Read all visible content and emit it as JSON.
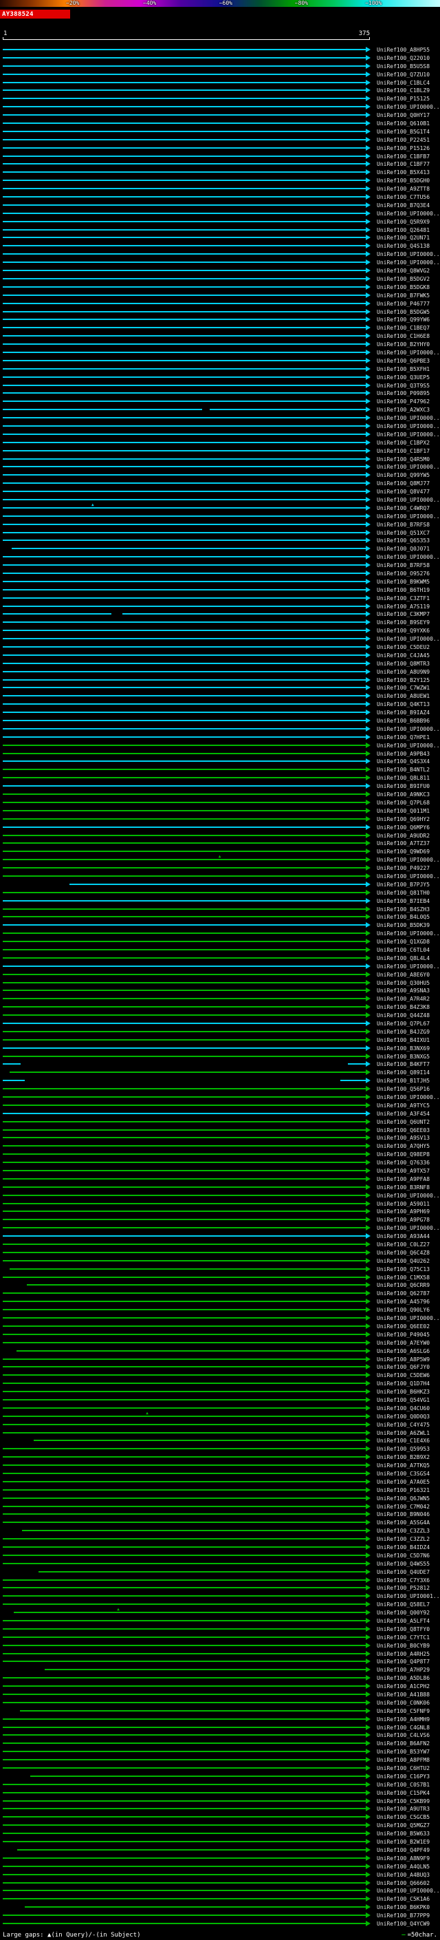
{
  "header": {
    "query_id": "AY388524",
    "scale_ticks": [
      {
        "label": "~20%",
        "pos": 15
      },
      {
        "label": "~40%",
        "pos": 32.5
      },
      {
        "label": "~60%",
        "pos": 49.8
      },
      {
        "label": "~80%",
        "pos": 67
      },
      {
        "label": "~100%",
        "pos": 83
      }
    ],
    "scale_gradient": [
      [
        0,
        "#2a0a00"
      ],
      [
        7,
        "#8a3300"
      ],
      [
        15,
        "#ff8000"
      ],
      [
        24,
        "#cc2090"
      ],
      [
        32,
        "#d000d0"
      ],
      [
        41,
        "#5000a0"
      ],
      [
        50,
        "#101090"
      ],
      [
        59,
        "#005030"
      ],
      [
        67,
        "#00a000"
      ],
      [
        76,
        "#00c860"
      ],
      [
        84,
        "#00e8e8"
      ],
      [
        100,
        "#c8ffff"
      ]
    ],
    "ruler": {
      "start": "1",
      "end": "375"
    }
  },
  "colors": {
    "cyan": "#00d0f0",
    "green": "#00b800",
    "query_bar": "#e00000",
    "label_text": "#e0e0e0",
    "ruler": "#ffffff",
    "background": "#000000"
  },
  "glyphs": {
    "gap_triangle": "▲"
  },
  "footer": {
    "left": "Large gaps: ▲(in Query)/-(in Subject)",
    "scale_dash": "—",
    "scale_text": "=50char."
  },
  "chart_data": {
    "type": "bar",
    "orientation": "horizontal",
    "title": "AY388524",
    "x_range": [
      1,
      375
    ],
    "legend_position": "top",
    "legend_meaning": "percent identity color scale (~20% to ~100%)",
    "rows": [
      {
        "l": "UniRef100_A8HP55",
        "c": "cyan"
      },
      {
        "l": "UniRef100_Q22010",
        "c": "cyan"
      },
      {
        "l": "UniRef100_B5U5S8",
        "c": "cyan"
      },
      {
        "l": "UniRef100_Q7ZU10",
        "c": "cyan"
      },
      {
        "l": "UniRef100_C1BLC4",
        "c": "cyan"
      },
      {
        "l": "UniRef100_C1BLZ9",
        "c": "cyan"
      },
      {
        "l": "UniRef100_P15125",
        "c": "cyan"
      },
      {
        "l": "UniRef100_UPI0000...",
        "c": "cyan"
      },
      {
        "l": "UniRef100_Q0HY17",
        "c": "cyan"
      },
      {
        "l": "UniRef100_Q610B1",
        "c": "cyan"
      },
      {
        "l": "UniRef100_B5G1T4",
        "c": "cyan"
      },
      {
        "l": "UniRef100_P22451",
        "c": "cyan"
      },
      {
        "l": "UniRef100_P15126",
        "c": "cyan"
      },
      {
        "l": "UniRef100_C1BFB7",
        "c": "cyan"
      },
      {
        "l": "UniRef100_C1BF77",
        "c": "cyan"
      },
      {
        "l": "UniRef100_B5X413",
        "c": "cyan"
      },
      {
        "l": "UniRef100_B5DGH0",
        "c": "cyan"
      },
      {
        "l": "UniRef100_A9ZTT8",
        "c": "cyan"
      },
      {
        "l": "UniRef100_C7TU56",
        "c": "cyan"
      },
      {
        "l": "UniRef100_B7Q3E4",
        "c": "cyan"
      },
      {
        "l": "UniRef100_UPI0000...",
        "c": "cyan"
      },
      {
        "l": "UniRef100_Q5R9X9",
        "c": "cyan"
      },
      {
        "l": "UniRef100_Q26481",
        "c": "cyan"
      },
      {
        "l": "UniRef100_Q2UN71",
        "c": "cyan"
      },
      {
        "l": "UniRef100_Q4S138",
        "c": "cyan"
      },
      {
        "l": "UniRef100_UPI0000...",
        "c": "cyan"
      },
      {
        "l": "UniRef100_UPI0000...",
        "c": "cyan"
      },
      {
        "l": "UniRef100_Q8WVG2",
        "c": "cyan"
      },
      {
        "l": "UniRef100_B5DGV2",
        "c": "cyan"
      },
      {
        "l": "UniRef100_B5DGK8",
        "c": "cyan"
      },
      {
        "l": "UniRef100_B7FWK5",
        "c": "cyan"
      },
      {
        "l": "UniRef100_P46777",
        "c": "cyan"
      },
      {
        "l": "UniRef100_B5DGW5",
        "c": "cyan"
      },
      {
        "l": "UniRef100_Q99YW6",
        "c": "cyan"
      },
      {
        "l": "UniRef100_C1BEQ7",
        "c": "cyan"
      },
      {
        "l": "UniRef100_C1H6E8",
        "c": "cyan"
      },
      {
        "l": "UniRef100_B2YHY0",
        "c": "cyan"
      },
      {
        "l": "UniRef100_UPI0000...",
        "c": "cyan"
      },
      {
        "l": "UniRef100_Q6PBE3",
        "c": "cyan"
      },
      {
        "l": "UniRef100_B5XFH1",
        "c": "cyan"
      },
      {
        "l": "UniRef100_Q3UEP5",
        "c": "cyan"
      },
      {
        "l": "UniRef100_Q3T9S5",
        "c": "cyan"
      },
      {
        "l": "UniRef100_P09895",
        "c": "cyan"
      },
      {
        "l": "UniRef100_P47962",
        "c": "cyan"
      },
      {
        "l": "UniRef100_A2WXC3",
        "c": "cyan",
        "seg": [
          [
            0,
            0.55
          ],
          [
            0.57,
            1
          ]
        ]
      },
      {
        "l": "UniRef100_UPI0000...",
        "c": "cyan"
      },
      {
        "l": "UniRef100_UPI0000...",
        "c": "cyan"
      },
      {
        "l": "UniRef100_UPI0000...",
        "c": "cyan"
      },
      {
        "l": "UniRef100_C1BPX2",
        "c": "cyan"
      },
      {
        "l": "UniRef100_C1BF17",
        "c": "cyan"
      },
      {
        "l": "UniRef100_Q4R5M0",
        "c": "cyan"
      },
      {
        "l": "UniRef100_UPI0000...",
        "c": "cyan"
      },
      {
        "l": "UniRef100_Q99YW5",
        "c": "cyan"
      },
      {
        "l": "UniRef100_Q8MJ77",
        "c": "cyan"
      },
      {
        "l": "UniRef100_Q8V477",
        "c": "cyan"
      },
      {
        "l": "UniRef100_UPI0000...",
        "c": "cyan"
      },
      {
        "l": "UniRef100_C4WRQ7",
        "c": "cyan",
        "m": [
          0.25
        ]
      },
      {
        "l": "UniRef100_UPI0000...",
        "c": "cyan"
      },
      {
        "l": "UniRef100_B7RFS8",
        "c": "cyan"
      },
      {
        "l": "UniRef100_Q51XC7",
        "c": "cyan"
      },
      {
        "l": "UniRef100_Q65353",
        "c": "cyan"
      },
      {
        "l": "UniRef100_Q0J071",
        "c": "cyan",
        "s": 10
      },
      {
        "l": "UniRef100_UPI0000...",
        "c": "cyan"
      },
      {
        "l": "UniRef100_B7RF58",
        "c": "cyan"
      },
      {
        "l": "UniRef100_O95276",
        "c": "cyan"
      },
      {
        "l": "UniRef100_B9KWM5",
        "c": "cyan"
      },
      {
        "l": "UniRef100_B6TH19",
        "c": "cyan"
      },
      {
        "l": "UniRef100_C3ZTF1",
        "c": "cyan"
      },
      {
        "l": "UniRef100_A7S119",
        "c": "cyan"
      },
      {
        "l": "UniRef100_C3KMP7",
        "c": "cyan",
        "seg": [
          [
            0,
            0.3
          ],
          [
            0.33,
            1
          ]
        ]
      },
      {
        "l": "UniRef100_B9SEY9",
        "c": "cyan"
      },
      {
        "l": "UniRef100_Q9YXK6",
        "c": "cyan"
      },
      {
        "l": "UniRef100_UPI0000...",
        "c": "cyan"
      },
      {
        "l": "UniRef100_C5DEU2",
        "c": "cyan"
      },
      {
        "l": "UniRef100_C4JA45",
        "c": "cyan"
      },
      {
        "l": "UniRef100_Q8MTR3",
        "c": "cyan"
      },
      {
        "l": "UniRef100_A8U9N9",
        "c": "cyan"
      },
      {
        "l": "UniRef100_B2Y125",
        "c": "cyan"
      },
      {
        "l": "UniRef100_C7WZW1",
        "c": "cyan"
      },
      {
        "l": "UniRef100_A8UEW1",
        "c": "cyan"
      },
      {
        "l": "UniRef100_Q4KT13",
        "c": "cyan"
      },
      {
        "l": "UniRef100_B9IAZ4",
        "c": "cyan"
      },
      {
        "l": "UniRef100_B6BB96",
        "c": "cyan"
      },
      {
        "l": "UniRef100_UPI0000...",
        "c": "cyan"
      },
      {
        "l": "UniRef100_Q7HPE1",
        "c": "cyan"
      },
      {
        "l": "UniRef100_UPI0000...",
        "c": "green"
      },
      {
        "l": "UniRef100_A9PB43",
        "c": "green"
      },
      {
        "l": "UniRef100_Q4S3X4",
        "c": "cyan"
      },
      {
        "l": "UniRef100_B4NTL2",
        "c": "green"
      },
      {
        "l": "UniRef100_Q8L811",
        "c": "green"
      },
      {
        "l": "UniRef100_B9IFU0",
        "c": "cyan"
      },
      {
        "l": "UniRef100_A9NKC3",
        "c": "green"
      },
      {
        "l": "UniRef100_Q7PL68",
        "c": "green"
      },
      {
        "l": "UniRef100_Q011M1",
        "c": "green"
      },
      {
        "l": "UniRef100_Q69HY2",
        "c": "green"
      },
      {
        "l": "UniRef100_Q6MPY6",
        "c": "cyan"
      },
      {
        "l": "UniRef100_A9UDR2",
        "c": "green"
      },
      {
        "l": "UniRef100_A7TZ37",
        "c": "green"
      },
      {
        "l": "UniRef100_Q9WD69",
        "c": "green"
      },
      {
        "l": "UniRef100_UPI0000...",
        "c": "green",
        "m": [
          0.6
        ]
      },
      {
        "l": "UniRef100_P49227",
        "c": "green"
      },
      {
        "l": "UniRef100_UPI0000...",
        "c": "green"
      },
      {
        "l": "UniRef100_B7PJY5",
        "c": "cyan",
        "s": 70
      },
      {
        "l": "UniRef100_Q81TH0",
        "c": "green"
      },
      {
        "l": "UniRef100_B7IEB4",
        "c": "cyan"
      },
      {
        "l": "UniRef100_B4SZH3",
        "c": "green"
      },
      {
        "l": "UniRef100_B4L0Q5",
        "c": "green"
      },
      {
        "l": "UniRef100_B5DK39",
        "c": "cyan"
      },
      {
        "l": "UniRef100_UPI0000...",
        "c": "green"
      },
      {
        "l": "UniRef100_Q1XGD8",
        "c": "green"
      },
      {
        "l": "UniRef100_C6TL04",
        "c": "green"
      },
      {
        "l": "UniRef100_Q8L4L4",
        "c": "green"
      },
      {
        "l": "UniRef100_UPI0000...",
        "c": "cyan"
      },
      {
        "l": "UniRef100_A8E6Y0",
        "c": "green"
      },
      {
        "l": "UniRef100_Q30HU5",
        "c": "green"
      },
      {
        "l": "UniRef100_A9SNA3",
        "c": "green"
      },
      {
        "l": "UniRef100_A7R4R2",
        "c": "green"
      },
      {
        "l": "UniRef100_B4Z3K8",
        "c": "green"
      },
      {
        "l": "UniRef100_Q44Z48",
        "c": "green"
      },
      {
        "l": "UniRef100_Q7PL67",
        "c": "cyan"
      },
      {
        "l": "UniRef100_B4JZG9",
        "c": "green"
      },
      {
        "l": "UniRef100_B4IXU1",
        "c": "green"
      },
      {
        "l": "UniRef100_B3NX69",
        "c": "cyan"
      },
      {
        "l": "UniRef100_B3NXG5",
        "c": "green"
      },
      {
        "l": "UniRef100_B4KFT7",
        "c": "cyan",
        "seg": [
          [
            0,
            0.05
          ],
          [
            0.95,
            1
          ]
        ]
      },
      {
        "l": "UniRef100_Q89I14",
        "c": "green",
        "s": 8
      },
      {
        "l": "UniRef100_B1TJH5",
        "c": "cyan",
        "seg": [
          [
            0,
            0.06
          ],
          [
            0.93,
            1
          ]
        ]
      },
      {
        "l": "UniRef100_Q56P16",
        "c": "green"
      },
      {
        "l": "UniRef100_UPI0000...",
        "c": "green"
      },
      {
        "l": "UniRef100_A9TYC5",
        "c": "green"
      },
      {
        "l": "UniRef100_A3F454",
        "c": "cyan"
      },
      {
        "l": "UniRef100_Q6UNT2",
        "c": "green"
      },
      {
        "l": "UniRef100_Q6EE03",
        "c": "green"
      },
      {
        "l": "UniRef100_A9SV13",
        "c": "green"
      },
      {
        "l": "UniRef100_A7QHY5",
        "c": "green"
      },
      {
        "l": "UniRef100_Q98EP8",
        "c": "green"
      },
      {
        "l": "UniRef100_Q76336",
        "c": "green"
      },
      {
        "l": "UniRef100_A9TX57",
        "c": "green"
      },
      {
        "l": "UniRef100_A9PFA8",
        "c": "green"
      },
      {
        "l": "UniRef100_B3RNF8",
        "c": "green"
      },
      {
        "l": "UniRef100_UPI0000...",
        "c": "green"
      },
      {
        "l": "UniRef100_A59011",
        "c": "green"
      },
      {
        "l": "UniRef100_A9PH69",
        "c": "green"
      },
      {
        "l": "UniRef100_A9PG78",
        "c": "green"
      },
      {
        "l": "UniRef100_UPI0000...",
        "c": "green"
      },
      {
        "l": "UniRef100_A93A44",
        "c": "cyan"
      },
      {
        "l": "UniRef100_C0LZ27",
        "c": "green"
      },
      {
        "l": "UniRef100_Q6C4Z8",
        "c": "green"
      },
      {
        "l": "UniRef100_Q4U262",
        "c": "green"
      },
      {
        "l": "UniRef100_Q75C13",
        "c": "green",
        "s": 8
      },
      {
        "l": "UniRef100_C1MX58",
        "c": "green"
      },
      {
        "l": "UniRef100_Q6CRR9",
        "c": "green",
        "s": 26
      },
      {
        "l": "UniRef100_Q62787",
        "c": "green"
      },
      {
        "l": "UniRef100_A45796",
        "c": "green"
      },
      {
        "l": "UniRef100_Q90LY6",
        "c": "green"
      },
      {
        "l": "UniRef100_UPI0000...",
        "c": "green"
      },
      {
        "l": "UniRef100_Q6EE02",
        "c": "green"
      },
      {
        "l": "UniRef100_P49045",
        "c": "green"
      },
      {
        "l": "UniRef100_A7EYW0",
        "c": "green"
      },
      {
        "l": "UniRef100_A6SLG6",
        "c": "green",
        "s": 15
      },
      {
        "l": "UniRef100_A8P5W9",
        "c": "green"
      },
      {
        "l": "UniRef100_Q6FJY0",
        "c": "green"
      },
      {
        "l": "UniRef100_C5DEW6",
        "c": "green"
      },
      {
        "l": "UniRef100_Q1D7H4",
        "c": "green"
      },
      {
        "l": "UniRef100_B6HKZ3",
        "c": "green"
      },
      {
        "l": "UniRef100_Q54VG1",
        "c": "green"
      },
      {
        "l": "UniRef100_Q4CU60",
        "c": "green"
      },
      {
        "l": "UniRef100_Q0D0Q3",
        "c": "green",
        "m": [
          0.4
        ]
      },
      {
        "l": "UniRef100_C4Y475",
        "c": "green"
      },
      {
        "l": "UniRef100_A6ZWL1",
        "c": "green"
      },
      {
        "l": "UniRef100_C1E4X6",
        "c": "green",
        "s": 33
      },
      {
        "l": "UniRef100_Q59953",
        "c": "green"
      },
      {
        "l": "UniRef100_B2B9X2",
        "c": "green"
      },
      {
        "l": "UniRef100_A7TKQ5",
        "c": "green"
      },
      {
        "l": "UniRef100_C3SGS4",
        "c": "green"
      },
      {
        "l": "UniRef100_A7A0E5",
        "c": "green"
      },
      {
        "l": "UniRef100_P16321",
        "c": "green"
      },
      {
        "l": "UniRef100_Q6JWN5",
        "c": "green"
      },
      {
        "l": "UniRef100_C7M042",
        "c": "green"
      },
      {
        "l": "UniRef100_B9N046",
        "c": "green"
      },
      {
        "l": "UniRef100_A5SG4A",
        "c": "green"
      },
      {
        "l": "UniRef100_C3ZZL3",
        "c": "green",
        "s": 21
      },
      {
        "l": "UniRef100_C3ZZL2",
        "c": "green"
      },
      {
        "l": "UniRef100_B4IDZ4",
        "c": "green"
      },
      {
        "l": "UniRef100_C5D7N6",
        "c": "green"
      },
      {
        "l": "UniRef100_Q4WS55",
        "c": "green"
      },
      {
        "l": "UniRef100_Q4UDE7",
        "c": "green",
        "s": 38
      },
      {
        "l": "UniRef100_C7Y3X6",
        "c": "green"
      },
      {
        "l": "UniRef100_P52812",
        "c": "green"
      },
      {
        "l": "UniRef100_UPI0001...",
        "c": "green"
      },
      {
        "l": "UniRef100_Q58EL7",
        "c": "green"
      },
      {
        "l": "UniRef100_Q00Y92",
        "c": "green",
        "s": 12,
        "m": [
          0.3
        ]
      },
      {
        "l": "UniRef100_A5LFT4",
        "c": "green"
      },
      {
        "l": "UniRef100_Q8TFY0",
        "c": "green"
      },
      {
        "l": "UniRef100_C7YTC1",
        "c": "green"
      },
      {
        "l": "UniRef100_B0CYB9",
        "c": "green"
      },
      {
        "l": "UniRef100_A4RH25",
        "c": "green"
      },
      {
        "l": "UniRef100_Q4P8T7",
        "c": "green"
      },
      {
        "l": "UniRef100_A7HP29",
        "c": "green",
        "s": 44
      },
      {
        "l": "UniRef100_A5DL86",
        "c": "green"
      },
      {
        "l": "UniRef100_A1CPH2",
        "c": "green"
      },
      {
        "l": "UniRef100_A41B88",
        "c": "green"
      },
      {
        "l": "UniRef100_C0NK06",
        "c": "green"
      },
      {
        "l": "UniRef100_C5FNF9",
        "c": "green",
        "s": 19
      },
      {
        "l": "UniRef100_A4HMH9",
        "c": "green"
      },
      {
        "l": "UniRef100_C4GNL8",
        "c": "green"
      },
      {
        "l": "UniRef100_C4LVS6",
        "c": "green"
      },
      {
        "l": "UniRef100_B6AFN2",
        "c": "green"
      },
      {
        "l": "UniRef100_B53YW7",
        "c": "green"
      },
      {
        "l": "UniRef100_A8PFM8",
        "c": "green"
      },
      {
        "l": "UniRef100_C6HTU2",
        "c": "green"
      },
      {
        "l": "UniRef100_C16PY3",
        "c": "green",
        "s": 29
      },
      {
        "l": "UniRef100_C0S7B1",
        "c": "green"
      },
      {
        "l": "UniRef100_C15PK4",
        "c": "green"
      },
      {
        "l": "UniRef100_C5KB99",
        "c": "green"
      },
      {
        "l": "UniRef100_A9UTR3",
        "c": "green"
      },
      {
        "l": "UniRef100_C5GCB5",
        "c": "green"
      },
      {
        "l": "UniRef100_Q5MGZ7",
        "c": "green"
      },
      {
        "l": "UniRef100_B5W633",
        "c": "green"
      },
      {
        "l": "UniRef100_B2W1E9",
        "c": "green"
      },
      {
        "l": "UniRef100_Q4PF49",
        "c": "green",
        "s": 16
      },
      {
        "l": "UniRef100_A8N9F9",
        "c": "green"
      },
      {
        "l": "UniRef100_A4QLN5",
        "c": "green"
      },
      {
        "l": "UniRef100_A4BUQ3",
        "c": "green"
      },
      {
        "l": "UniRef100_Q66602",
        "c": "green"
      },
      {
        "l": "UniRef100_UPI0000...",
        "c": "green"
      },
      {
        "l": "UniRef100_C5K1A6",
        "c": "green"
      },
      {
        "l": "UniRef100_B6KPK0",
        "c": "green",
        "s": 24
      },
      {
        "l": "UniRef100_B77PP9",
        "c": "green"
      },
      {
        "l": "UniRef100_Q4YCW9",
        "c": "green"
      }
    ]
  }
}
